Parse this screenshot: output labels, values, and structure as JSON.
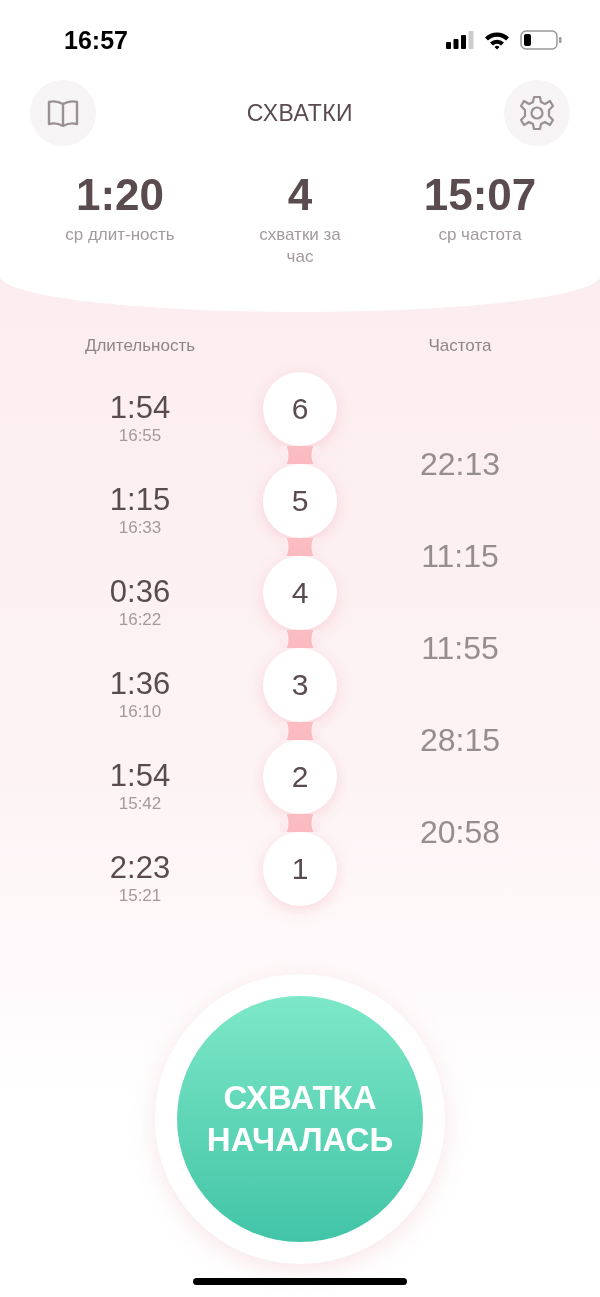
{
  "status_bar": {
    "time": "16:57"
  },
  "header": {
    "title": "СХВАТКИ"
  },
  "stats": [
    {
      "value": "1:20",
      "label": "ср длит-ность"
    },
    {
      "value": "4",
      "label": "схватки за час"
    },
    {
      "value": "15:07",
      "label": "ср частота"
    }
  ],
  "columns": {
    "duration": "Длительность",
    "frequency": "Частота"
  },
  "contractions": [
    {
      "number": "6",
      "duration": "1:54",
      "start": "16:55"
    },
    {
      "number": "5",
      "duration": "1:15",
      "start": "16:33"
    },
    {
      "number": "4",
      "duration": "0:36",
      "start": "16:22"
    },
    {
      "number": "3",
      "duration": "1:36",
      "start": "16:10"
    },
    {
      "number": "2",
      "duration": "1:54",
      "start": "15:42"
    },
    {
      "number": "1",
      "duration": "2:23",
      "start": "15:21"
    }
  ],
  "intervals": [
    "22:13",
    "11:15",
    "11:55",
    "28:15",
    "20:58"
  ],
  "start_button": {
    "label": "СХВАТКА НАЧАЛАСЬ"
  }
}
